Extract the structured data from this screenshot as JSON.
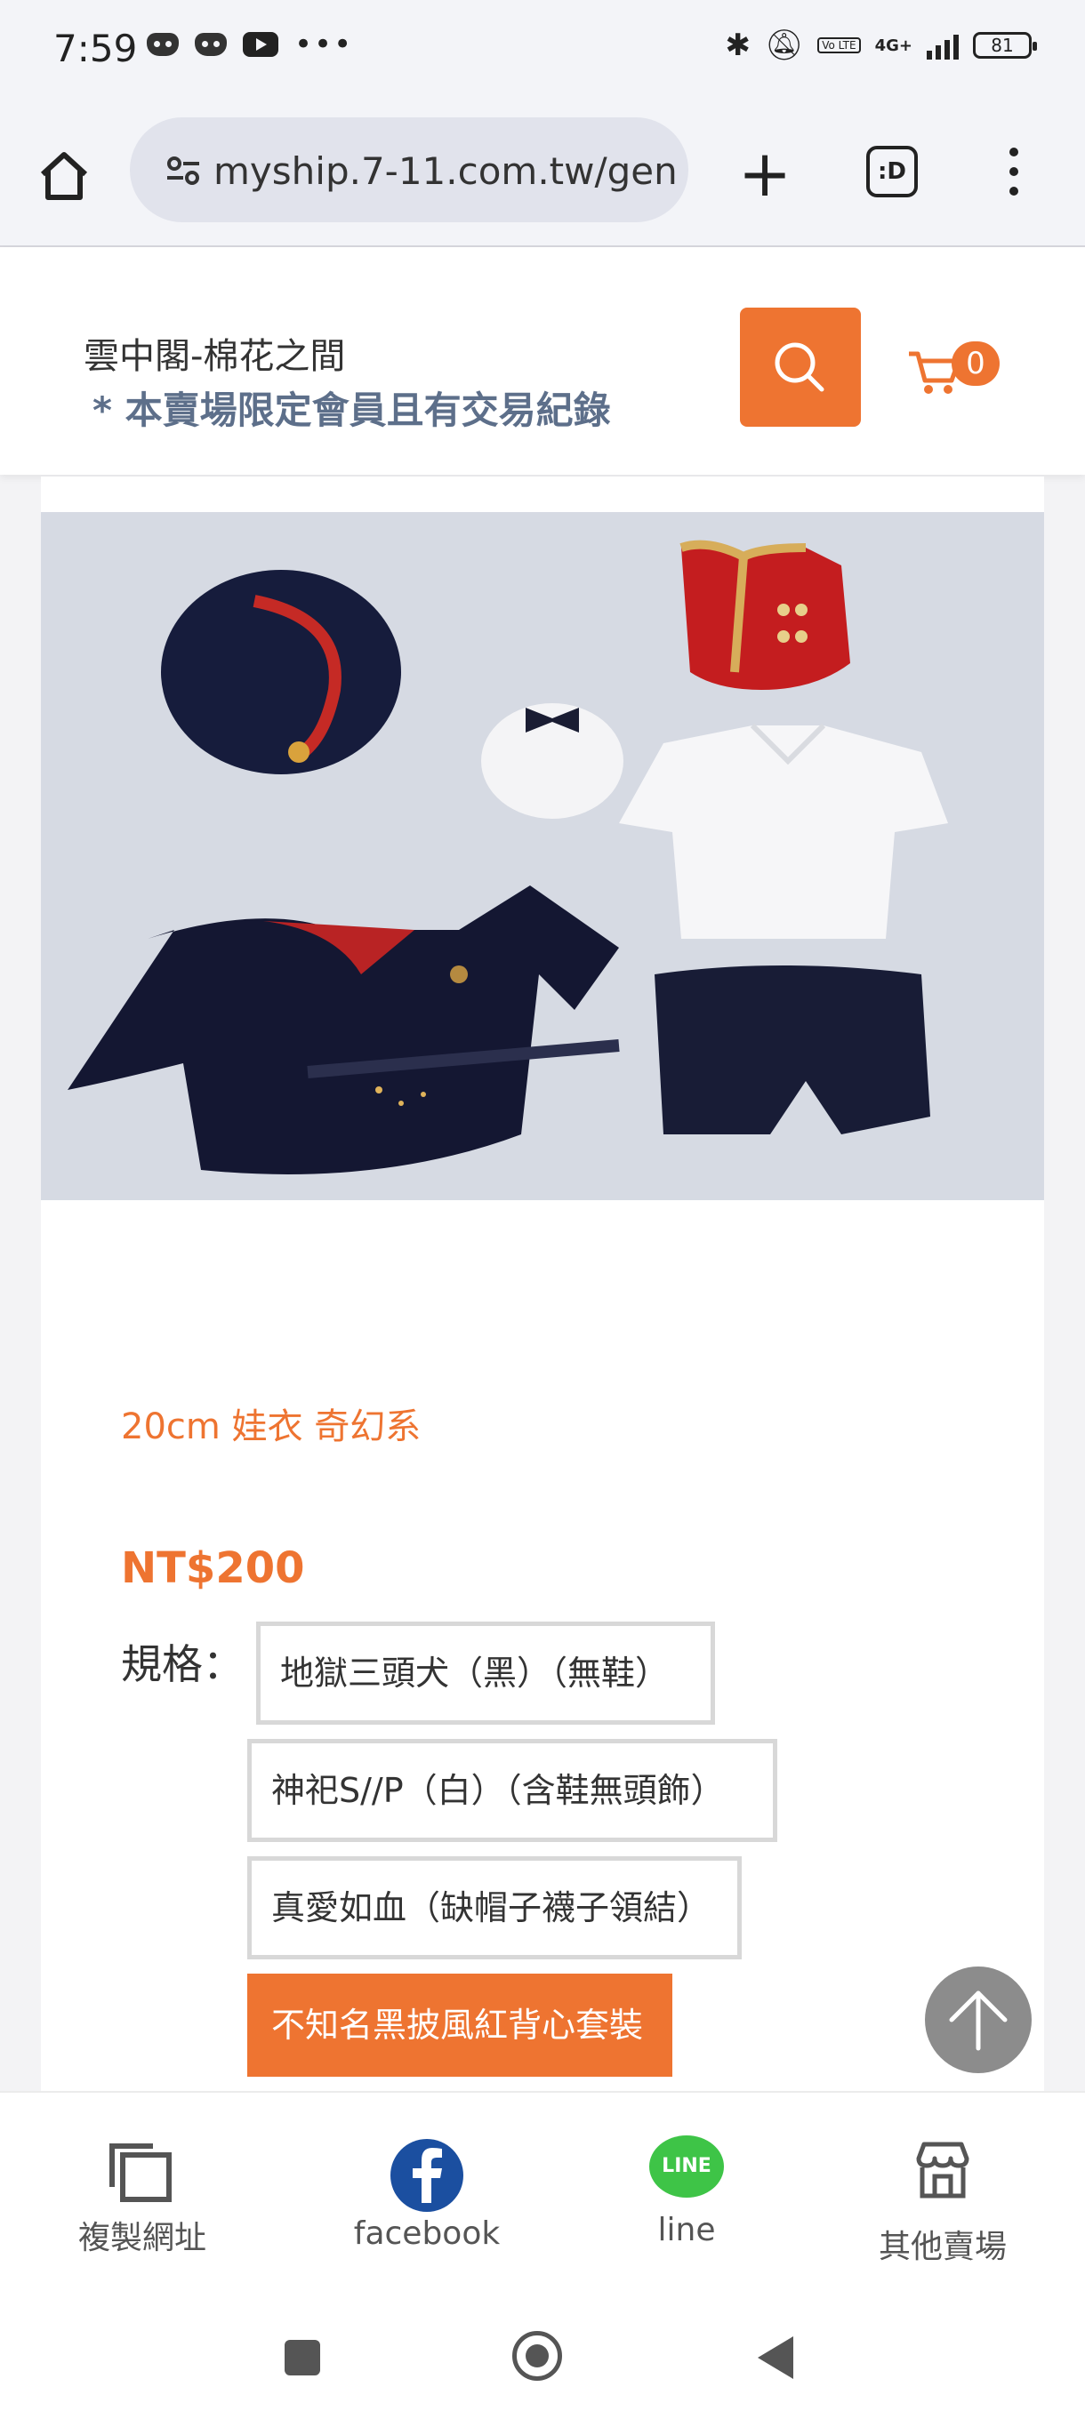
{
  "status_bar": {
    "time": "7:59",
    "battery": "81",
    "network": "4G+",
    "volte": "Vo LTE"
  },
  "browser": {
    "url": "myship.7-11.com.tw/gen",
    "tabs_label": ":D"
  },
  "header": {
    "shop_name": "雲中閣-棉花之間",
    "notice": "* 本賣場限定會員且有交易紀錄",
    "cart_count": "0"
  },
  "product": {
    "title": "20cm 娃衣 奇幻系",
    "price": "NT$200",
    "spec_label": "規格：",
    "options": [
      {
        "label": "地獄三頭犬（黑）（無鞋）",
        "selected": false
      },
      {
        "label": "神祀S//P（白）（含鞋無頭飾）",
        "selected": false
      },
      {
        "label": "真愛如血（缺帽子襪子領結）",
        "selected": false
      },
      {
        "label": "不知名黑披風紅背心套裝",
        "selected": true
      }
    ]
  },
  "share_bar": {
    "copy_url": "複製網址",
    "facebook": "facebook",
    "line": "line",
    "line_logo": "LINE",
    "other_shops": "其他賣場"
  },
  "colors": {
    "accent": "#ee7431",
    "notice": "#5d6f8a",
    "facebook": "#1b4fa0",
    "line": "#3ec447"
  }
}
